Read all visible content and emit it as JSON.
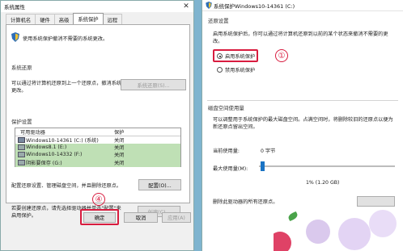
{
  "left_dialog": {
    "title": "系统属性",
    "tabs": [
      "计算机名",
      "硬件",
      "高级",
      "系统保护",
      "远程"
    ],
    "active_tab": "系统保护",
    "intro": "使用系统保护撤消不需要的系统更改。",
    "restore_section_title": "系统还原",
    "restore_desc": "可以通过将计算机还原到上一个还原点，撤消系统更改。",
    "restore_button": "系统还原(S)...",
    "protection_section_title": "保护设置",
    "table_headers": {
      "drive": "可用驱动器",
      "protection": "保护"
    },
    "drives": [
      {
        "name": "Windows10-14361 (C:) (系统)",
        "status": "关闭",
        "highlight": false
      },
      {
        "name": "Windows8.1 (E:)",
        "status": "关闭",
        "highlight": true
      },
      {
        "name": "Windows10-14332 (F:)",
        "status": "关闭",
        "highlight": true
      },
      {
        "name": "阴影要保存 (G:)",
        "status": "关闭",
        "highlight": true
      }
    ],
    "configure_desc": "配置还原设置、管理磁盘空间，并且删除还原点。",
    "configure_button": "配置(O)...",
    "create_desc": "若要创建还原点，请先选择驱动器并单击\"配置\"来启用保护。",
    "create_button": "创建(C)...",
    "ok_button": "确定",
    "cancel_button": "取消",
    "apply_button": "应用(A)",
    "callout_number": "④"
  },
  "right_dialog": {
    "title": "系统保护Windows10-14361 (C:)",
    "restore_settings_title": "还原设置",
    "restore_settings_desc": "启用系统保护后，你可以通过将计算机还原到以前的某个状态来撤消不需要的更改。",
    "option_enable": "启用系统保护",
    "option_disable": "禁用系统保护",
    "callout_number": "①",
    "disk_usage_title": "磁盘空间使用量",
    "disk_usage_desc": "可以调整用于系统保护的最大磁盘空间。占满空间时，将删除较旧的还原点以便为新还原点留出空间。",
    "current_usage_label": "当前使用量:",
    "current_usage_value": "0 字节",
    "max_usage_label": "最大使用量(M):",
    "slider_value": "1% (1.20 GB)",
    "slider_fraction": 0.01,
    "delete_desc": "删除此驱动器的所有还原点。"
  }
}
